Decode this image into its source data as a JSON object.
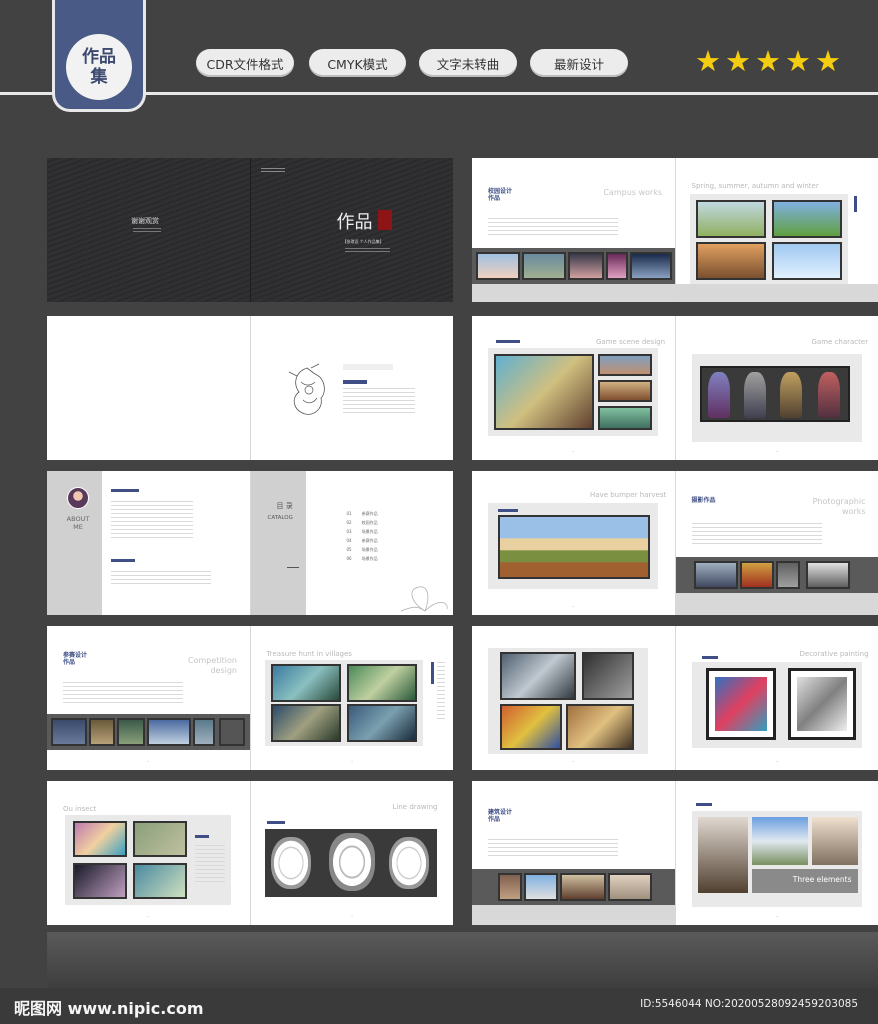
{
  "header": {
    "badge": "作品集",
    "pills": [
      "CDR文件格式",
      "CMYK模式",
      "文字未转曲",
      "最新设计"
    ],
    "star_count": 5,
    "star_color": "#f4cc10"
  },
  "cover": {
    "left_text": "谢谢观赏",
    "right_title": "作品",
    "right_subtitle": "【张琪设 个人作品集】"
  },
  "about": {
    "label": "ABOUT ME"
  },
  "catalog": {
    "title": "目 录",
    "subtitle": "CATALOG",
    "items": [
      {
        "num": "01",
        "label": "参赛作品"
      },
      {
        "num": "02",
        "label": "校园作品"
      },
      {
        "num": "03",
        "label": "场景作品"
      },
      {
        "num": "04",
        "label": "参赛作品"
      },
      {
        "num": "05",
        "label": "场景作品"
      },
      {
        "num": "06",
        "label": "场景作品"
      }
    ]
  },
  "spreads": {
    "campus": {
      "heading": "校园设计 作品",
      "title": "Campus works"
    },
    "seasons": {
      "title": "Spring, summer, autumn and winter"
    },
    "game_scene": {
      "title": "Game scene design"
    },
    "game_character": {
      "title": "Game character"
    },
    "harvest": {
      "title": "Have bumper harvest"
    },
    "photo": {
      "heading": "摄影作品",
      "title": "Photographic works"
    },
    "competition": {
      "heading": "参赛设计 作品",
      "title": "Competition design"
    },
    "treasure": {
      "title": "Treasure hunt in villages"
    },
    "decorative": {
      "title": "Decorative painting"
    },
    "insect": {
      "title": "Ou insect"
    },
    "line": {
      "title": "Line drawing"
    },
    "architecture": {
      "heading": "建筑设计 作品"
    },
    "three": {
      "title": "Three elements"
    }
  },
  "watermark": {
    "left": "昵图网 www.nipic.com",
    "right": "ID:5546044 NO:20200528092459203085"
  }
}
